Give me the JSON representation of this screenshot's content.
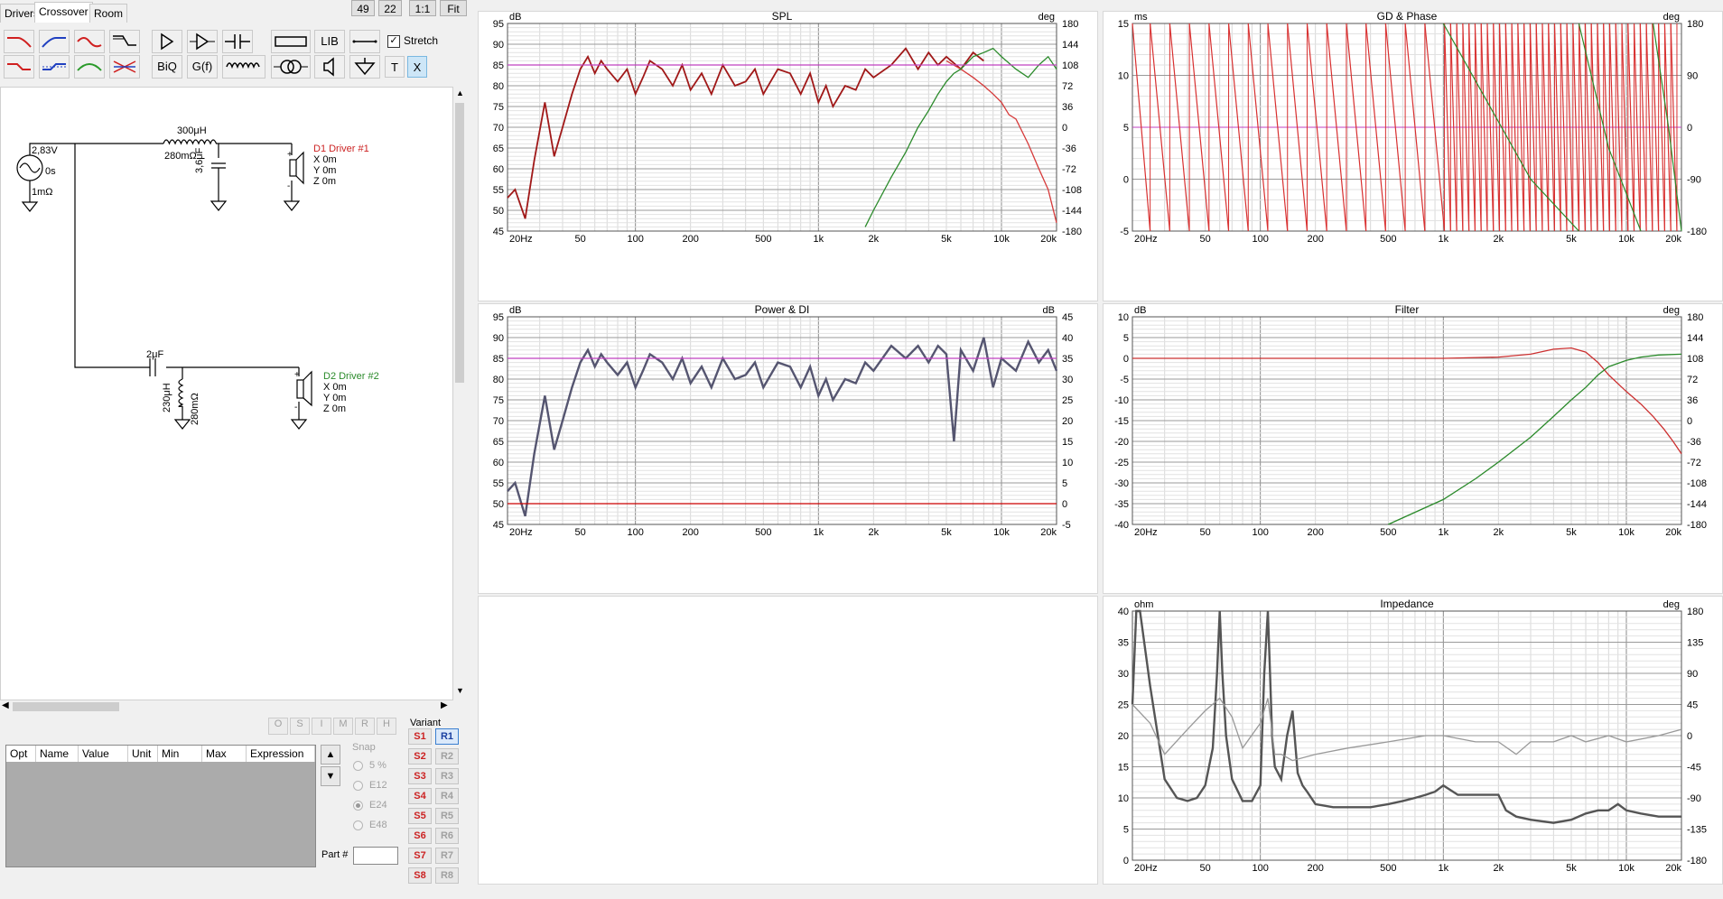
{
  "tabs": [
    {
      "label": "Drivers"
    },
    {
      "label": "Crossover"
    },
    {
      "label": "Room"
    }
  ],
  "top_buttons": [
    "49",
    "22",
    "1:1",
    "Fit"
  ],
  "toolbar": {
    "lib": "LIB",
    "biq": "BiQ",
    "gf": "G(f)",
    "stretch": "Stretch",
    "t": "T",
    "x": "X"
  },
  "schematic": {
    "source_v": "2,83V",
    "source_delay": "0s",
    "source_r": "1mΩ",
    "l1": "300μH",
    "l1_r": "280mΩ",
    "c1": "3,6μF",
    "d1_name": "D1 Driver #1",
    "d1_x": "X 0m",
    "d1_y": "Y 0m",
    "d1_z": "Z 0m",
    "c2": "2μF",
    "l2": "230μH",
    "l2_r": "280mΩ",
    "d2_name": "D2 Driver #2",
    "d2_x": "X 0m",
    "d2_y": "Y 0m",
    "d2_z": "Z 0m",
    "colors": {
      "d1": "#cc2222",
      "d2": "#2a8a2a"
    }
  },
  "opt_buttons": [
    "O",
    "S",
    "I",
    "M",
    "R",
    "H"
  ],
  "table": {
    "headers": [
      "Opt",
      "Name",
      "Value",
      "Unit",
      "Min",
      "Max",
      "Expression"
    ]
  },
  "snap": {
    "label": "Snap",
    "options": [
      "5 %",
      "E12",
      "E24",
      "E48"
    ],
    "selected": "E24"
  },
  "part": {
    "label": "Part #",
    "value": ""
  },
  "variant": {
    "label": "Variant",
    "s": [
      "S1",
      "S2",
      "S3",
      "S4",
      "S5",
      "S6",
      "S7",
      "S8"
    ],
    "r": [
      "R1",
      "R2",
      "R3",
      "R4",
      "R5",
      "R6",
      "R7",
      "R8"
    ],
    "active_r": "R1"
  },
  "x_ticks": [
    "20Hz",
    "50",
    "100",
    "200",
    "500",
    "1k",
    "2k",
    "5k",
    "10k",
    "20k"
  ],
  "charts": {
    "spl": {
      "title": "SPL",
      "left_unit": "dB",
      "right_unit": "deg",
      "left_ticks": [
        "95",
        "90",
        "85",
        "80",
        "75",
        "70",
        "65",
        "60",
        "55",
        "50",
        "45"
      ],
      "right_ticks": [
        "180",
        "144",
        "108",
        "72",
        "36",
        "0",
        "-36",
        "-72",
        "-108",
        "-144",
        "-180"
      ]
    },
    "gd": {
      "title": "GD & Phase",
      "left_unit": "ms",
      "right_unit": "deg",
      "left_ticks": [
        "15",
        "10",
        "5",
        "0",
        "-5"
      ],
      "right_ticks": [
        "180",
        "90",
        "0",
        "-90",
        "-180"
      ]
    },
    "power": {
      "title": "Power & DI",
      "left_unit": "dB",
      "right_unit": "dB",
      "left_ticks": [
        "95",
        "90",
        "85",
        "80",
        "75",
        "70",
        "65",
        "60",
        "55",
        "50",
        "45"
      ],
      "right_ticks": [
        "45",
        "40",
        "35",
        "30",
        "25",
        "20",
        "15",
        "10",
        "5",
        "0",
        "-5"
      ]
    },
    "filter": {
      "title": "Filter",
      "left_unit": "dB",
      "right_unit": "deg",
      "left_ticks": [
        "10",
        "5",
        "0",
        "-5",
        "-10",
        "-15",
        "-20",
        "-25",
        "-30",
        "-35",
        "-40"
      ],
      "right_ticks": [
        "180",
        "144",
        "108",
        "72",
        "36",
        "0",
        "-36",
        "-72",
        "-108",
        "-144",
        "-180"
      ]
    },
    "imp": {
      "title": "Impedance",
      "left_unit": "ohm",
      "right_unit": "deg",
      "left_ticks": [
        "40",
        "35",
        "30",
        "25",
        "20",
        "15",
        "10",
        "5",
        "0"
      ],
      "right_ticks": [
        "180",
        "135",
        "90",
        "45",
        "0",
        "-45",
        "-90",
        "-135",
        "-180"
      ]
    }
  },
  "chart_data": [
    {
      "type": "line",
      "title": "SPL",
      "ylabel": "dB",
      "ylim": [
        45,
        95
      ],
      "y2label": "deg",
      "y2lim": [
        -180,
        180
      ],
      "xscale": "log",
      "xlim": [
        20,
        20000
      ],
      "series": [
        {
          "color": "#a01818",
          "x": [
            20,
            22,
            25,
            28,
            32,
            36,
            40,
            45,
            50,
            55,
            60,
            65,
            70,
            80,
            90,
            100,
            110,
            120,
            140,
            160,
            180,
            200,
            230,
            260,
            300,
            350,
            400,
            450,
            500,
            600,
            700,
            800,
            900,
            1000,
            1100,
            1200,
            1400,
            1600,
            1800,
            2000,
            2500,
            3000,
            3500,
            4000,
            4500,
            5000,
            6000,
            7000,
            8000
          ],
          "y": [
            53,
            55,
            48,
            62,
            76,
            63,
            70,
            78,
            84,
            87,
            83,
            86,
            84,
            81,
            84,
            78,
            82,
            86,
            84,
            80,
            85,
            79,
            83,
            78,
            85,
            80,
            81,
            84,
            78,
            84,
            83,
            78,
            83,
            76,
            80,
            75,
            80,
            79,
            84,
            82,
            85,
            89,
            84,
            88,
            85,
            87,
            84,
            88,
            86
          ]
        },
        {
          "color": "#d63a3a",
          "x": [
            5000,
            6000,
            7000,
            8000,
            9000,
            10000,
            11000,
            12000,
            14000,
            16000,
            18000,
            20000
          ],
          "y": [
            86,
            84,
            82,
            80,
            78,
            76,
            73,
            72,
            66,
            60,
            55,
            47
          ]
        },
        {
          "color": "#2a8a2a",
          "x": [
            1800,
            2000,
            2500,
            3000,
            3500,
            4000,
            4500,
            5000,
            5500,
            6000,
            7000,
            8000,
            9000,
            10000,
            12000,
            14000,
            16000,
            18000,
            20000
          ],
          "y": [
            46,
            50,
            58,
            64,
            70,
            74,
            78,
            81,
            83,
            84,
            87,
            88,
            89,
            87,
            84,
            82,
            85,
            87,
            84
          ]
        },
        {
          "color": "#c040c0",
          "x": [
            20,
            20000
          ],
          "y": [
            85,
            85
          ]
        }
      ]
    },
    {
      "type": "line",
      "title": "Power & DI",
      "ylabel": "dB",
      "ylim": [
        45,
        95
      ],
      "y2label": "dB",
      "y2lim": [
        -5,
        45
      ],
      "xscale": "log",
      "xlim": [
        20,
        20000
      ],
      "series": [
        {
          "color": "#555570",
          "x": [
            20,
            22,
            25,
            28,
            32,
            36,
            40,
            45,
            50,
            55,
            60,
            65,
            70,
            80,
            90,
            100,
            110,
            120,
            140,
            160,
            180,
            200,
            230,
            260,
            300,
            350,
            400,
            450,
            500,
            600,
            700,
            800,
            900,
            1000,
            1100,
            1200,
            1400,
            1600,
            1800,
            2000,
            2500,
            3000,
            3500,
            4000,
            4500,
            5000,
            5500,
            6000,
            7000,
            8000,
            9000,
            10000,
            12000,
            14000,
            16000,
            18000,
            20000
          ],
          "y": [
            53,
            55,
            47,
            62,
            76,
            63,
            70,
            78,
            84,
            87,
            83,
            86,
            84,
            81,
            84,
            78,
            82,
            86,
            84,
            80,
            85,
            79,
            83,
            78,
            85,
            80,
            81,
            84,
            78,
            84,
            83,
            78,
            83,
            76,
            80,
            75,
            80,
            79,
            84,
            82,
            88,
            85,
            88,
            84,
            88,
            86,
            65,
            87,
            82,
            90,
            78,
            85,
            82,
            89,
            84,
            87,
            82
          ]
        },
        {
          "color": "#cc0000",
          "x": [
            20,
            20000
          ],
          "y": [
            50,
            50
          ]
        },
        {
          "color": "#c040c0",
          "x": [
            20,
            20000
          ],
          "y": [
            85,
            85
          ]
        }
      ]
    },
    {
      "type": "line",
      "title": "Filter",
      "ylabel": "dB",
      "ylim": [
        -40,
        10
      ],
      "y2label": "deg",
      "y2lim": [
        -180,
        180
      ],
      "xscale": "log",
      "xlim": [
        20,
        20000
      ],
      "series": [
        {
          "color": "#cc3030",
          "x": [
            20,
            100,
            500,
            1000,
            2000,
            3000,
            4000,
            5000,
            6000,
            7000,
            8000,
            10000,
            12000,
            14000,
            16000,
            18000,
            20000
          ],
          "y": [
            0,
            0,
            0,
            0,
            0.3,
            1,
            2.2,
            2.5,
            1.5,
            -1,
            -4,
            -8,
            -11,
            -14,
            -17,
            -20,
            -23
          ]
        },
        {
          "color": "#2a8a2a",
          "x": [
            500,
            1000,
            1500,
            2000,
            3000,
            4000,
            5000,
            6000,
            7000,
            8000,
            10000,
            12000,
            15000,
            20000
          ],
          "y": [
            -40,
            -34,
            -29,
            -25,
            -19,
            -14,
            -10,
            -7,
            -4,
            -2,
            -0.5,
            0.3,
            0.8,
            1
          ]
        }
      ]
    },
    {
      "type": "line",
      "title": "Impedance",
      "ylabel": "ohm",
      "ylim": [
        0,
        40
      ],
      "y2label": "deg",
      "y2lim": [
        -180,
        180
      ],
      "xscale": "log",
      "xlim": [
        20,
        20000
      ],
      "series": [
        {
          "color": "#555555",
          "x": [
            20,
            21,
            22,
            25,
            30,
            35,
            40,
            45,
            50,
            55,
            58,
            60,
            62,
            65,
            70,
            80,
            90,
            100,
            105,
            110,
            113,
            116,
            120,
            130,
            140,
            150,
            160,
            170,
            180,
            200,
            250,
            300,
            400,
            500,
            600,
            700,
            800,
            900,
            1000,
            1200,
            1500,
            2000,
            2200,
            2500,
            3000,
            4000,
            5000,
            6000,
            7000,
            8000,
            9000,
            10000,
            12000,
            15000,
            20000
          ],
          "y": [
            25,
            45,
            50,
            28,
            13,
            10,
            9.5,
            10,
            12,
            18,
            30,
            48,
            30,
            20,
            13,
            9.5,
            9.5,
            12,
            30,
            48,
            30,
            20,
            15,
            13,
            20,
            24,
            14,
            12,
            11,
            9,
            8.5,
            8.5,
            8.5,
            9,
            9.5,
            10,
            10.5,
            11,
            12,
            10.5,
            10.5,
            10.5,
            8,
            7,
            6.5,
            6,
            6.5,
            7.5,
            8,
            8,
            9,
            8,
            7.5,
            7,
            7
          ]
        },
        {
          "color": "#999999",
          "x": [
            20,
            25,
            30,
            40,
            50,
            60,
            70,
            80,
            100,
            110,
            120,
            130,
            150,
            200,
            300,
            500,
            800,
            1000,
            1500,
            2000,
            2500,
            3000,
            4000,
            5000,
            6000,
            8000,
            10000,
            15000,
            20000
          ],
          "y": [
            25,
            22,
            17,
            21,
            24,
            26,
            23,
            18,
            22,
            26,
            17,
            17,
            16,
            17,
            18,
            19,
            20,
            20,
            19,
            19,
            17,
            19,
            19,
            20,
            19,
            20,
            19,
            20,
            21
          ]
        }
      ]
    }
  ]
}
